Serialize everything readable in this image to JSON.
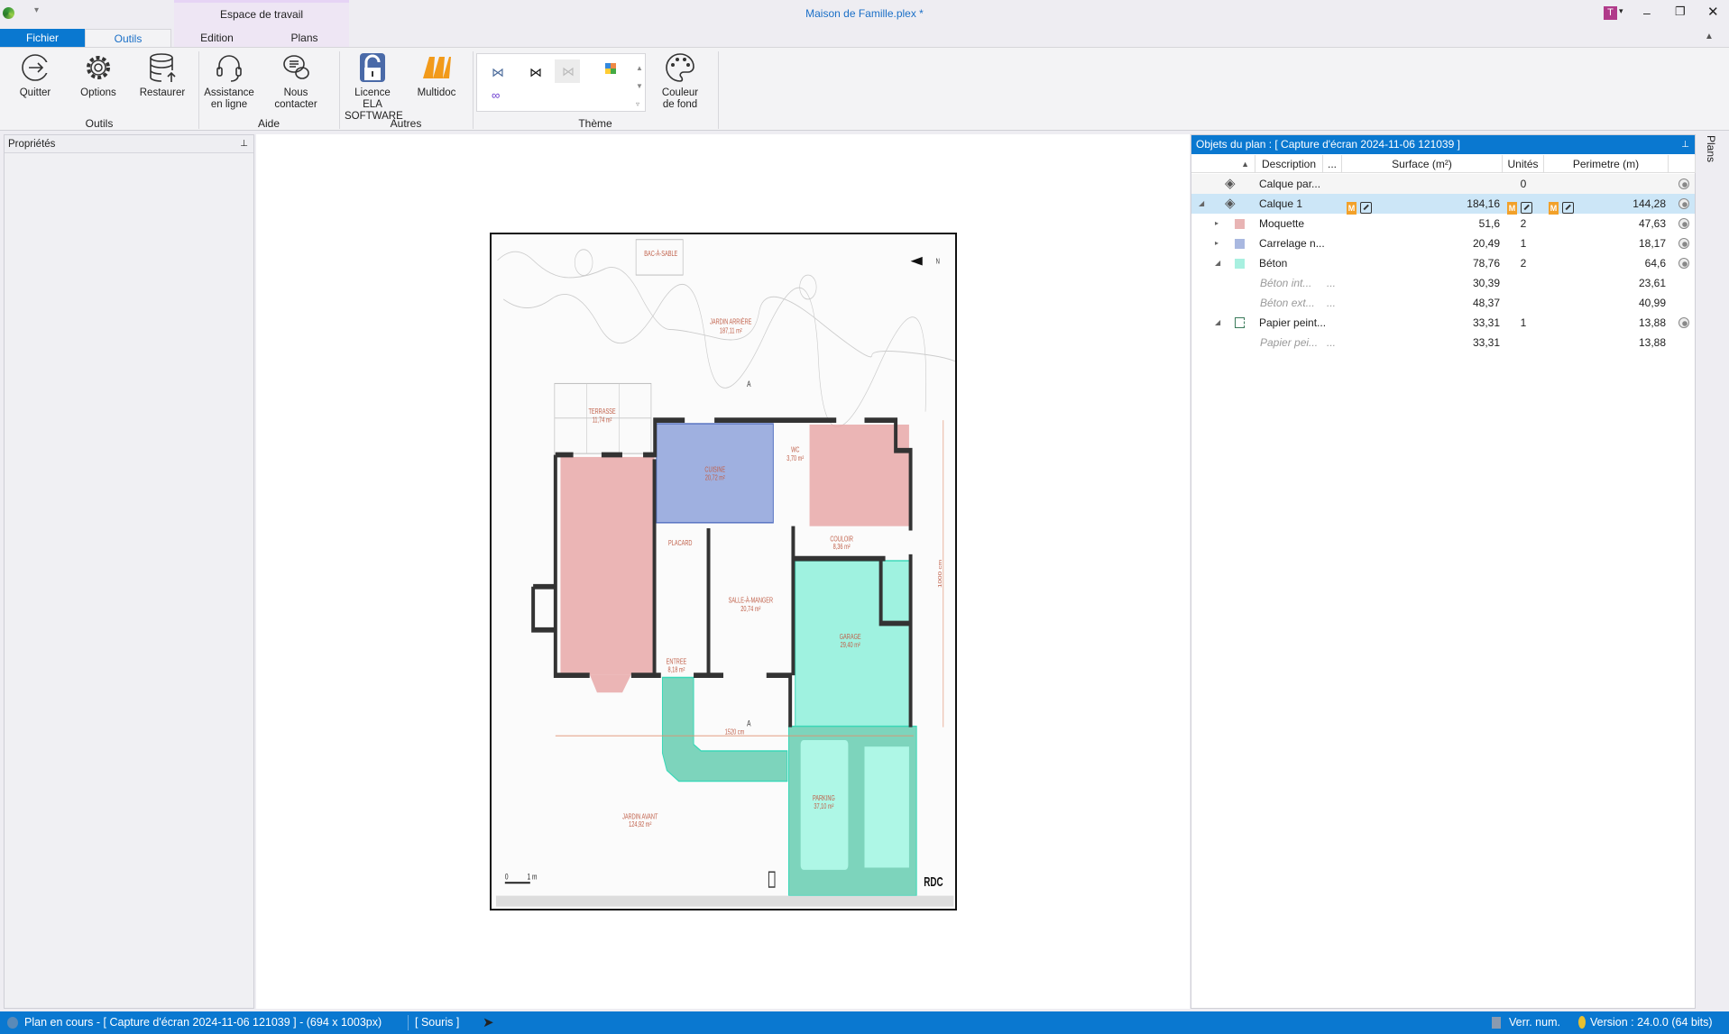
{
  "app": {
    "workspace_label": "Espace de travail",
    "document_title": "Maison de Famille.plex *",
    "user_initial": "T"
  },
  "tabs": [
    {
      "label": "Fichier"
    },
    {
      "label": "Outils"
    },
    {
      "label": "Edition"
    },
    {
      "label": "Plans"
    }
  ],
  "ribbon": {
    "groups": [
      {
        "label": "Outils"
      },
      {
        "label": "Aide"
      },
      {
        "label": "Autres"
      },
      {
        "label": "Thème"
      }
    ],
    "buttons": {
      "quitter": "Quitter",
      "options": "Options",
      "restaurer": "Restaurer",
      "assistance1": "Assistance",
      "assistance2": "en ligne",
      "contact": "Nous contacter",
      "licence1": "Licence ELA",
      "licence2": "SOFTWARE",
      "multidoc": "Multidoc",
      "couleur1": "Couleur",
      "couleur2": "de fond"
    }
  },
  "properties": {
    "title": "Propriétés"
  },
  "objects_panel": {
    "title": "Objets du plan : [ Capture d'écran 2024-11-06 121039 ]",
    "columns": {
      "description": "Description",
      "more": "...",
      "surface": "Surface (m²)",
      "unites": "Unités",
      "perimetre": "Perimetre (m)"
    },
    "rows": [
      {
        "desc": "Calque par...",
        "surface": "",
        "unites": "0",
        "perimetre": "",
        "icon": "layers-icon"
      },
      {
        "desc": "Calque 1",
        "surface": "184,16",
        "unites": "",
        "perimetre": "144,28",
        "icon": "layers-icon",
        "selected": true
      },
      {
        "desc": "Moquette",
        "surface": "51,6",
        "unites": "2",
        "perimetre": "47,63",
        "color": "#e8b4b4"
      },
      {
        "desc": "Carrelage n...",
        "surface": "20,49",
        "unites": "1",
        "perimetre": "18,17",
        "color": "#a9b8e0"
      },
      {
        "desc": "Béton",
        "surface": "78,76",
        "unites": "2",
        "perimetre": "64,6",
        "color": "#a8f0e0"
      },
      {
        "desc": "Béton int...",
        "more": "...",
        "surface": "30,39",
        "unites": "",
        "perimetre": "23,61"
      },
      {
        "desc": "Béton ext...",
        "more": "...",
        "surface": "48,37",
        "unites": "",
        "perimetre": "40,99"
      },
      {
        "desc": "Papier peint...",
        "surface": "33,31",
        "unites": "1",
        "perimetre": "13,88",
        "icon": "wall-outline-icon"
      },
      {
        "desc": "Papier pei...",
        "more": "...",
        "surface": "33,31",
        "unites": "",
        "perimetre": "13,88"
      }
    ],
    "badge_letter": "M"
  },
  "side_tab": {
    "label": "Plans"
  },
  "plan": {
    "labels": {
      "bac": "BAC-À-SABLE",
      "jardin_arriere": "JARDIN ARRIÈRE",
      "jardin_arriere_area": "187,11 m²",
      "terrasse": "TERRASSE",
      "terrasse_area": "11,74 m²",
      "cuisine": "CUISINE",
      "cuisine_area": "20,72 m²",
      "wc": "WC",
      "wc_area": "3,70 m²",
      "placard": "PLACARD",
      "couloir": "COULOIR",
      "couloir_area": "8,36 m²",
      "salle": "SALLE-À-MANGER",
      "salle_area": "20,74 m²",
      "garage": "GARAGE",
      "garage_area": "29,40 m²",
      "entree": "ENTREE",
      "entree_area": "8,18 m²",
      "parking": "PARKING",
      "parking_area": "37,10 m²",
      "jardin_avant": "JARDIN AVANT",
      "jardin_avant_area": "124,92 m²",
      "dim_h": "1520 cm",
      "dim_v": "1000 cm",
      "section": "A",
      "north": "N",
      "scale0": "0",
      "scale1": "1 m",
      "level": "RDC"
    },
    "colors": {
      "moquette": "#e8a8a8",
      "carrelage": "#8fa4dc",
      "beton": "#5ee8c8"
    }
  },
  "status": {
    "text": "Plan en cours - [ Capture d'écran 2024-11-06 121039 ] - (694 x 1003px)",
    "mode": "[ Souris ]",
    "numlock": "Verr. num.",
    "version": "Version : 24.0.0 (64 bits)"
  },
  "colors": {
    "accent": "#0a78d0"
  }
}
